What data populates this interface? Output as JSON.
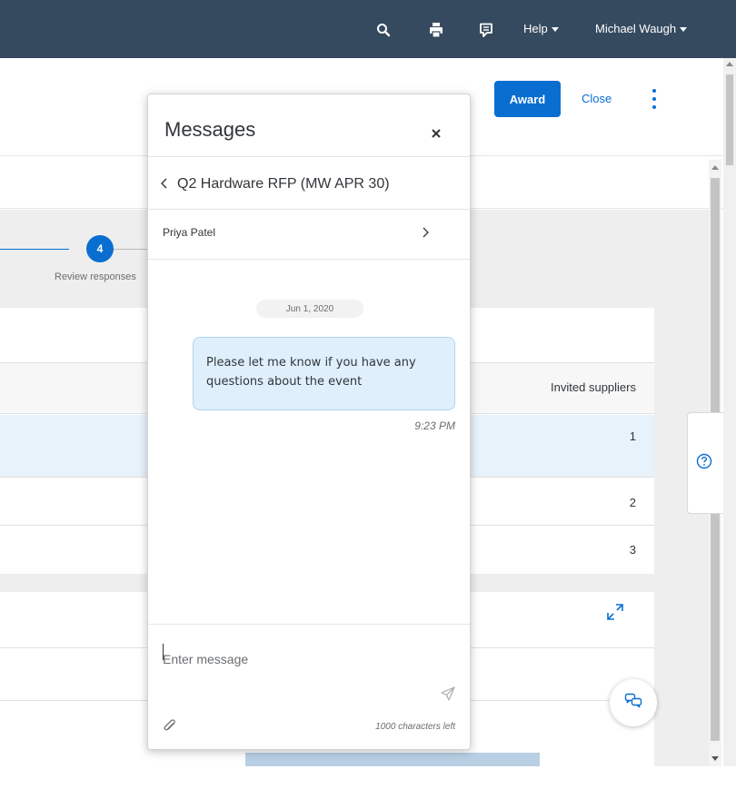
{
  "header": {
    "help_label": "Help",
    "user_name": "Michael Waugh",
    "background_color": "#354a5f"
  },
  "toolbar": {
    "award_label": "Award",
    "close_label": "Close",
    "accent_color": "#0a6ed1"
  },
  "progress": {
    "step_number": "4",
    "step_label": "Review responses"
  },
  "table": {
    "column_header": "Invited suppliers",
    "rows": [
      {
        "invited_suppliers": "1",
        "selected": true
      },
      {
        "invited_suppliers": "2",
        "selected": false
      },
      {
        "invited_suppliers": "3",
        "selected": false
      }
    ]
  },
  "messages_panel": {
    "title": "Messages",
    "event_title": "Q2 Hardware RFP (MW APR 30)",
    "contact_name": "Priya Patel",
    "date_chip": "Jun 1, 2020",
    "messages": [
      {
        "text": "Please let me know if you have any questions about the event",
        "time": "9:23 PM"
      }
    ],
    "input_placeholder": "Enter message",
    "char_counter": "1000 characters left"
  },
  "icons": {
    "search": "search-icon",
    "print": "print-icon",
    "feedback": "feedback-icon",
    "more": "overflow-icon",
    "help": "question-circle-icon",
    "expand": "expand-icon",
    "chat": "chat-bubbles-icon",
    "close": "close-icon",
    "back": "chevron-left-icon",
    "forward": "chevron-right-icon",
    "send": "send-icon",
    "attach": "paperclip-icon"
  }
}
